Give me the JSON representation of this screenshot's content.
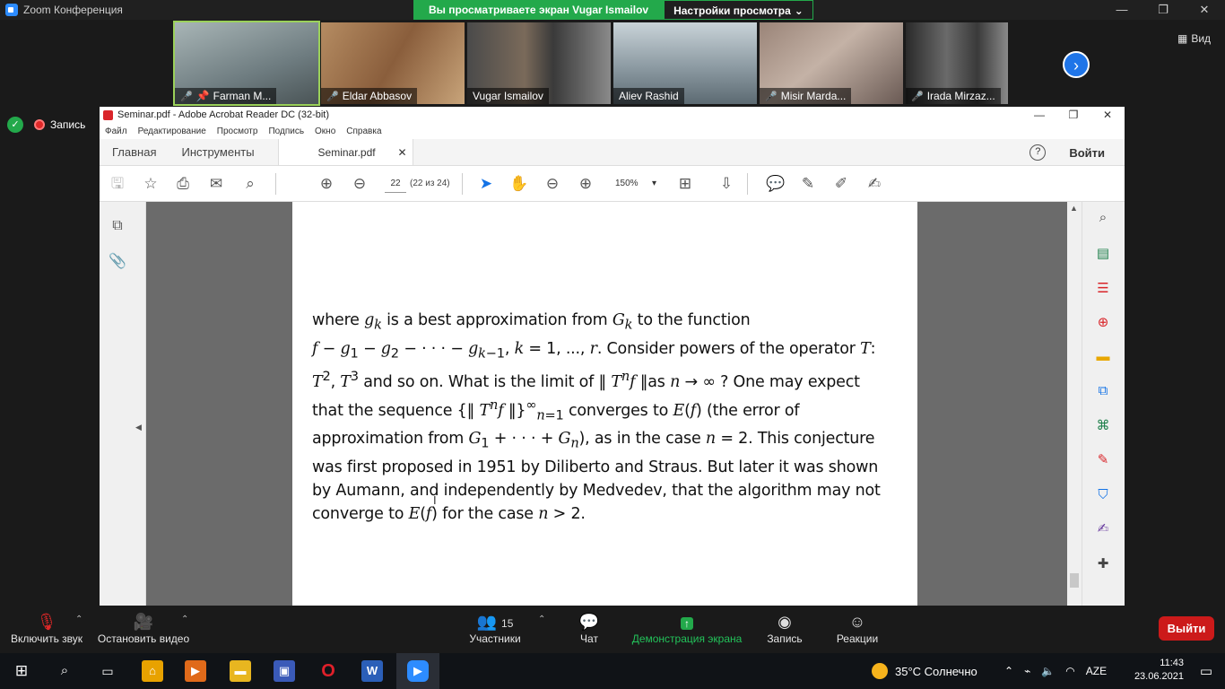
{
  "zoom": {
    "title": "Zoom Конференция",
    "share_banner": "Вы просматриваете экран Vugar Ismailov",
    "view_options": "Настройки просмотра",
    "view_label": "Вид",
    "recording_label": "Запись",
    "window_controls": [
      "—",
      "❐",
      "✕"
    ]
  },
  "participants": [
    {
      "name": "Farman M...",
      "muted": true,
      "color": "#7a8a8a"
    },
    {
      "name": "Eldar Abbasov",
      "muted": true,
      "color": "#8a6a4a"
    },
    {
      "name": "Vugar Ismailov",
      "muted": false,
      "color": "#6a6a6a"
    },
    {
      "name": "Aliev Rashid",
      "muted": false,
      "color": "#7c8c96"
    },
    {
      "name": "Misir Marda...",
      "muted": true,
      "color": "#8a7a7a"
    },
    {
      "name": "Irada Mirzaz...",
      "muted": true,
      "color": "#5a5a5a"
    }
  ],
  "acrobat": {
    "title": "Seminar.pdf - Adobe Acrobat Reader DC (32-bit)",
    "menu": [
      "Файл",
      "Редактирование",
      "Просмотр",
      "Подпись",
      "Окно",
      "Справка"
    ],
    "tabs": {
      "home": "Главная",
      "tools": "Инструменты",
      "doc": "Seminar.pdf"
    },
    "sign_in": "Войти",
    "page_number": "22",
    "page_count": "(22 из 24)",
    "zoom_level": "150%"
  },
  "pdf": {
    "paragraph_html": "where <i>g<sub>k</sub></i> is a best approximation from <i>G<sub>k</sub></i> to the function<br><i>f</i> − <i>g</i><sub>1</sub> − <i>g</i><sub>2</sub> − · · · − <i>g<sub>k</sub></i><sub>−1</sub>, <i>k</i> = 1, ..., <i>r</i>. Consider powers of the operator <i>T</i>:<br><i>T</i><sup>2</sup>, <i>T</i><sup>3</sup> and so on. What is the limit of ‖ <i>T<sup>n</sup>f</i> ‖as <i>n</i> → ∞ ? One may expect<br>that the sequence {‖ <i>T<sup>n</sup>f</i> ‖}<sup>∞</sup><sub><i>n</i>=1</sub> converges to <i>E</i>(<i>f</i>) (the error of<br>approximation from <i>G</i><sub>1</sub> + · · · + <i>G<sub>n</sub></i>), as in the case <i>n</i> = 2. This conjecture<br>was first proposed in 1951 by Diliberto and Straus. But later it was shown<br>by Aumann, and independently by Medvedev, that the algorithm may not<br>converge to <i>E</i>(<i>f</i>) for the case <i>n</i> &gt; 2."
  },
  "controls": {
    "audio": "Включить звук",
    "video": "Остановить видео",
    "participants": "Участники",
    "participants_count": "15",
    "chat": "Чат",
    "share": "Демонстрация экрана",
    "record": "Запись",
    "reactions": "Реакции",
    "leave": "Выйти"
  },
  "taskbar": {
    "weather": "35°C  Солнечно",
    "language": "AZE",
    "time": "11:43",
    "date": "23.06.2021"
  }
}
